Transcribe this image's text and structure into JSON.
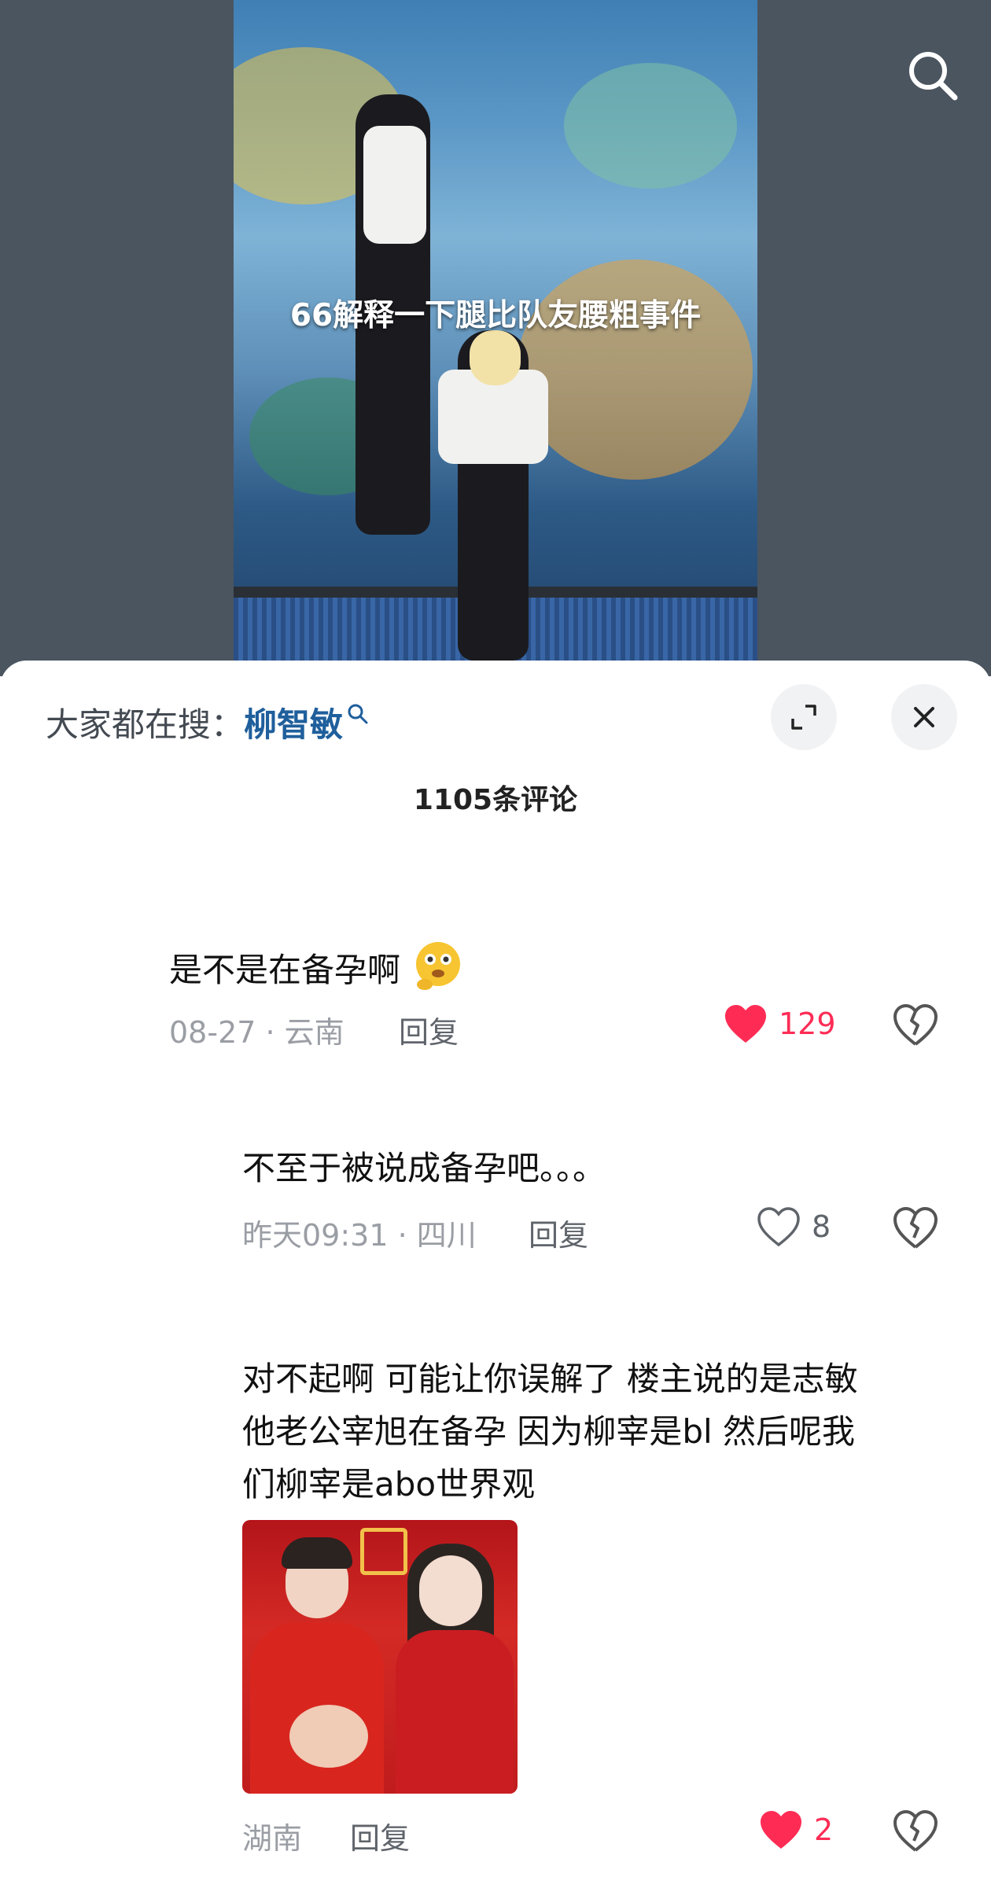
{
  "video": {
    "caption": "66解释一下腿比队友腰粗事件"
  },
  "sheet": {
    "trending_label": "大家都在搜：",
    "trending_keyword": "柳智敏",
    "comment_count": "1105条评论"
  },
  "comments": [
    {
      "text": "是不是在备孕啊",
      "date": "08-27 · 云南",
      "reply": "回复",
      "likes": "129",
      "liked": true
    },
    {
      "text": "不至于被说成备孕吧。。。",
      "date": "昨天09:31 · 四川",
      "reply": "回复",
      "likes": "8",
      "liked": false
    },
    {
      "text_lines": [
        "对不起啊 可能让你误解了 楼主说的是志敏",
        "他老公宰旭在备孕 因为柳宰是bl 然后呢我",
        "们柳宰是abo世界观"
      ],
      "date": "湖南",
      "reply": "回复",
      "likes": "2",
      "liked": true
    }
  ],
  "colors": {
    "like_red": "#fe2c55",
    "keyword_blue": "#1f5f9c"
  },
  "icons": {
    "search": "search-icon",
    "expand": "expand-icon",
    "close": "close-icon",
    "heart": "heart-icon",
    "dislike": "broken-heart-icon",
    "emoji": "thinking-emoji-icon"
  }
}
